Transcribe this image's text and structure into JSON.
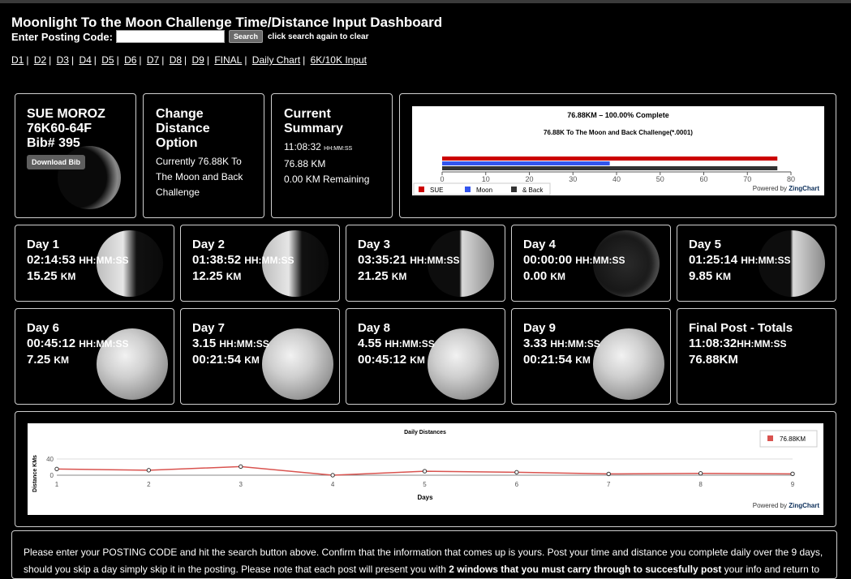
{
  "header": {
    "title": "Moonlight To the Moon Challenge Time/Distance Input Dashboard",
    "posting_label": "Enter Posting Code:",
    "search_label": "Search",
    "search_hint": "click search again to clear"
  },
  "nav": [
    "D1",
    "D2",
    "D3",
    "D4",
    "D5",
    "D6",
    "D7",
    "D8",
    "D9",
    "FINAL",
    "Daily Chart",
    "6K/10K Input"
  ],
  "profile": {
    "name": "SUE MOROZ",
    "code": "76K60-64F",
    "bib": "Bib# 395",
    "download_label": "Download Bib"
  },
  "distance_option": {
    "heading_1": "Change",
    "heading_2": "Distance",
    "heading_3": "Option",
    "text": "Currently 76.88K To The Moon and Back Challenge"
  },
  "summary": {
    "heading_1": "Current",
    "heading_2": "Summary",
    "time": "11:08:32",
    "time_unit": "HH:MM:SS",
    "distance": "76.88 KM",
    "remaining": "0.00 KM Remaining"
  },
  "days": [
    {
      "label": "Day 1",
      "line1": "02:14:53",
      "unit1": "HH:MM:SS",
      "line2": "15.25",
      "unit2": "KM"
    },
    {
      "label": "Day 2",
      "line1": "01:38:52",
      "unit1": "HH:MM:SS",
      "line2": "12.25",
      "unit2": "KM"
    },
    {
      "label": "Day 3",
      "line1": "03:35:21",
      "unit1": "HH:MM:SS",
      "line2": "21.25",
      "unit2": "KM"
    },
    {
      "label": "Day 4",
      "line1": "00:00:00",
      "unit1": "HH:MM:SS",
      "line2": "0.00",
      "unit2": "KM"
    },
    {
      "label": "Day 5",
      "line1": "01:25:14",
      "unit1": "HH:MM:SS",
      "line2": "9.85",
      "unit2": "KM"
    },
    {
      "label": "Day 6",
      "line1": "00:45:12",
      "unit1": "HH:MM:SS",
      "line2": "7.25",
      "unit2": "KM"
    },
    {
      "label": "Day 7",
      "line1": "3.15",
      "unit1": "HH:MM:SS",
      "line2": "00:21:54",
      "unit2": "KM"
    },
    {
      "label": "Day 8",
      "line1": "4.55",
      "unit1": "HH:MM:SS",
      "line2": "00:45:12",
      "unit2": "KM"
    },
    {
      "label": "Day 9",
      "line1": "3.33",
      "unit1": "HH:MM:SS",
      "line2": "00:21:54",
      "unit2": "KM"
    }
  ],
  "final": {
    "label": "Final Post - Totals",
    "time": "11:08:32",
    "unit": "HH:MM:SS",
    "distance": "76.88KM"
  },
  "powered_by": "Powered by",
  "zingchart": "ZingChart",
  "chart_data": [
    {
      "type": "bar",
      "title": "76.88KM – 100.00% Complete",
      "subtitle": "76.88K To The Moon and Back Challenge(*.0001)",
      "orientation": "horizontal",
      "xlim": [
        0,
        80
      ],
      "ticks": [
        0,
        10,
        20,
        30,
        40,
        50,
        60,
        70,
        80
      ],
      "series": [
        {
          "name": "SUE",
          "value": 76.88,
          "color": "#cc0000"
        },
        {
          "name": "Moon",
          "value": 38.44,
          "color": "#3355ee"
        },
        {
          "name": "& Back",
          "value": 76.88,
          "color": "#333333"
        }
      ],
      "legend": "bottom-left"
    },
    {
      "type": "line",
      "title": "Daily Distances",
      "xlabel": "Days",
      "ylabel": "Distance KMs",
      "x": [
        1,
        2,
        3,
        4,
        5,
        6,
        7,
        8,
        9
      ],
      "y": [
        15.25,
        12.25,
        21.25,
        0.0,
        9.85,
        7.25,
        3.15,
        4.55,
        3.33
      ],
      "yticks": [
        0,
        40
      ],
      "ylim": [
        0,
        40
      ],
      "series_name": "76.88KM",
      "color": "#d9534f",
      "legend": "top-right"
    }
  ],
  "footer": {
    "line1": "Please enter your POSTING CODE and hit the search button above. Confirm that the information that comes up is yours. Post your time and distance you complete daily over the 9 days,",
    "line2_a": "should you skip a day simply skip it in the posting. Please note that each post will present you with ",
    "line2_b": "2 windows that you must carry through to succesfully post",
    "line2_c": " your info and return to"
  }
}
